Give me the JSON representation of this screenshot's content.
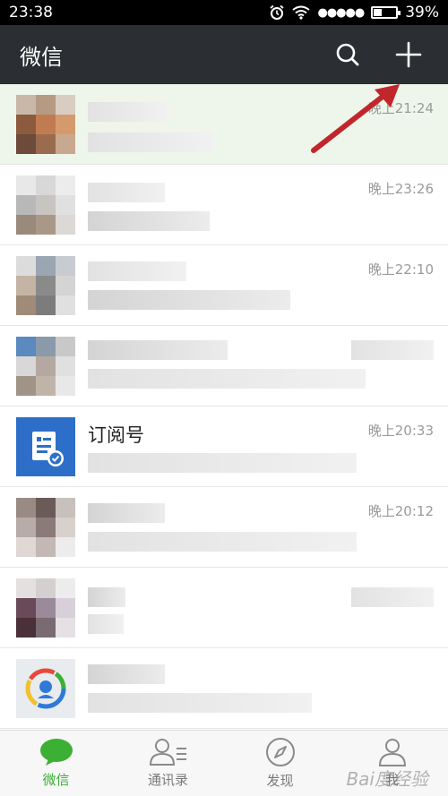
{
  "status_bar": {
    "time": "23:38",
    "signal": "●●●●●",
    "battery": "39%",
    "battery_level": 0.39
  },
  "header": {
    "title": "微信",
    "search_icon": "search-icon",
    "add_icon": "plus-icon"
  },
  "chats": [
    {
      "time": "晚上21:24"
    },
    {
      "time": "晚上23:26"
    },
    {
      "time": "晚上22:10"
    },
    {
      "time": ""
    },
    {
      "name": "订阅号",
      "time": "晚上20:33"
    },
    {
      "time": "晚上20:12"
    },
    {
      "time": ""
    },
    {
      "time": ""
    }
  ],
  "tabs": [
    {
      "label": "微信",
      "icon": "chat-bubble-icon",
      "active": true
    },
    {
      "label": "通讯录",
      "icon": "contacts-icon",
      "active": false
    },
    {
      "label": "发现",
      "icon": "compass-icon",
      "active": false
    },
    {
      "label": "我",
      "icon": "person-icon",
      "active": false
    }
  ],
  "watermark": "Bai度经验",
  "colors": {
    "header": "#2b2f33",
    "accent": "#3cb034",
    "arrow": "#c0262c",
    "subscription": "#2d6fc8"
  }
}
